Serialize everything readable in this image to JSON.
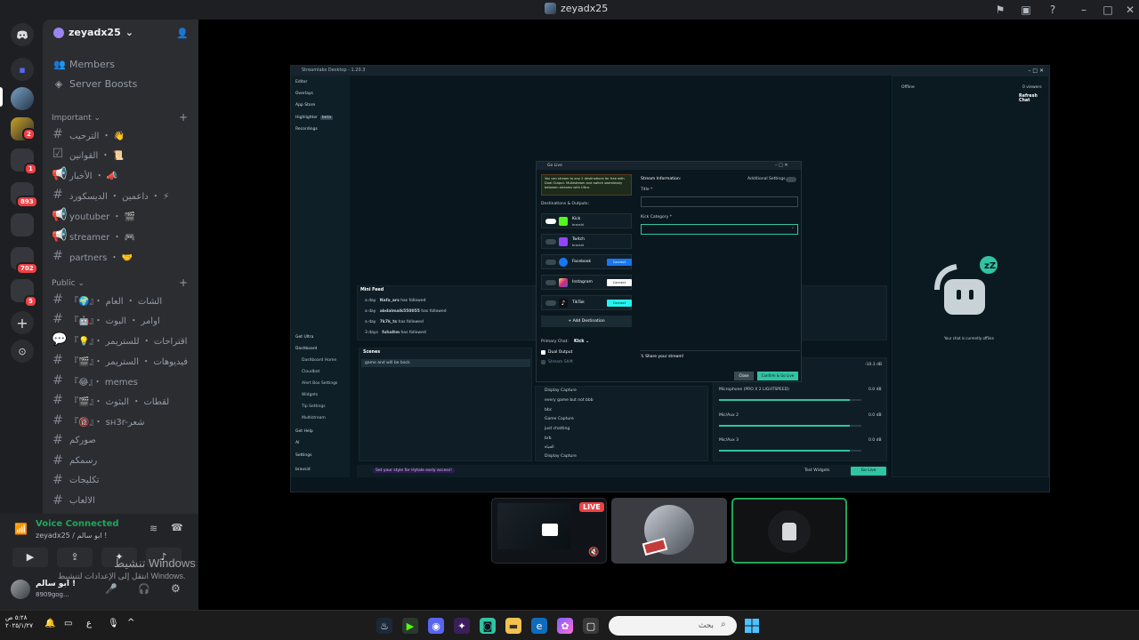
{
  "window": {
    "title": "zeyadx25"
  },
  "server": {
    "name": "zeyadx25"
  },
  "sidebar": {
    "top_items": [
      {
        "label": "Members",
        "icon": "members-icon"
      },
      {
        "label": "Server Boosts",
        "icon": "boost-icon"
      }
    ],
    "categories": [
      {
        "label": "Important",
        "channels": [
          {
            "label": "الترحيب ・ 👋",
            "type": "text"
          },
          {
            "label": "القوانين ・ 📜",
            "type": "rules"
          },
          {
            "label": "الأخبار ・ 📣",
            "type": "announce"
          },
          {
            "label": "داعمين ・ الديسكورد ・ ⚡",
            "type": "text"
          },
          {
            "label": "youtuber ・ 🎬",
            "type": "announce"
          },
          {
            "label": "streamer ・ 🎮",
            "type": "announce"
          },
          {
            "label": "partners ・ 🤝",
            "type": "text"
          }
        ]
      },
      {
        "label": "Public",
        "channels": [
          {
            "label": "『🌍』・ الشات ・ العام",
            "type": "text"
          },
          {
            "label": "『🤖』・ اوامر ・ البوت",
            "type": "text"
          },
          {
            "label": "『💡』・ اقتراحات ・ للستريمر",
            "type": "forum"
          },
          {
            "label": "『🎬』・ فيديوهات ・ الستريمر",
            "type": "text"
          },
          {
            "label": "『😂』・ memes",
            "type": "text"
          },
          {
            "label": "『🎬』・ لقطات ・ البثوث",
            "type": "text"
          },
          {
            "label": "『🔞』・ sн3r-شعر",
            "type": "text"
          },
          {
            "label": "صوركم",
            "type": "text"
          },
          {
            "label": "رسمكم",
            "type": "text"
          },
          {
            "label": "تكليجات",
            "type": "text"
          },
          {
            "label": "الالعاب",
            "type": "text"
          }
        ]
      }
    ]
  },
  "rail_badges": [
    "2",
    "1",
    "893",
    "702",
    "5"
  ],
  "voice": {
    "status": "Voice Connected",
    "channel": "zeyadx25 / ابو سالم !",
    "user_name": "ابو سالم !",
    "user_tag": "8909gog...",
    "watermark_title": "تنشيط Windows",
    "watermark_sub": "انتقل إلى الإعدادات لتنشيط Windows."
  },
  "streamlabs": {
    "title": "Streamlabs Desktop - 1.20.3",
    "nav": [
      "Editor",
      "Overlays",
      "App Store",
      "Highlighter",
      "Recordings"
    ],
    "highlighter_badge": "beta",
    "nav_bottom": [
      "Get Ultra",
      "Dashboard",
      "Dashboard Home",
      "Cloudbot",
      "Alert Box Settings",
      "Widgets",
      "Tip Settings",
      "Multistream",
      "Get Help",
      "AI",
      "Settings",
      "bravsid"
    ],
    "chat": {
      "status": "Offline",
      "viewers": "0 viewers",
      "refresh": "Refresh Chat",
      "offline_msg": "Your chat is currently offline"
    },
    "mini_feed": {
      "title": "Mini Feed",
      "events": [
        {
          "time": "a day",
          "user": "Nafa_ars",
          "action": "has followed"
        },
        {
          "time": "a day",
          "user": "abdalmalk550055",
          "action": "has followed"
        },
        {
          "time": "a day",
          "user": "7k7k_ts",
          "action": "has followed"
        },
        {
          "time": "3 days",
          "user": "fuhaltm",
          "action": "has followed"
        }
      ]
    },
    "scenes": {
      "title": "Scenes",
      "items": [
        "game and will be back"
      ]
    },
    "sources": [
      "Display Capture",
      "every game but not bbb",
      "bbc",
      "Game Capture",
      "just chatting",
      "brb",
      "الحياة",
      "Display Capture"
    ],
    "mixer": [
      {
        "name": "Microphone (PRO X 2 LIGHTSPEED)",
        "db": "0.0 dB",
        "level": 0.92
      },
      {
        "name": "Mic/Aux 2",
        "db": "0.0 dB",
        "level": 0.92
      },
      {
        "name": "Mic/Aux 3",
        "db": "0.0 dB",
        "level": 0.92
      }
    ],
    "mixer_top_db": "-10.3 dB",
    "footer": {
      "promo": "Set your style for Hytale early access!",
      "test_widgets": "Test Widgets",
      "go_live": "Go Live"
    }
  },
  "golive": {
    "title": "Go Live",
    "notice": "You can stream to any 2 destinations for free with Dual Output. Multistream and switch seamlessly between streams with Ultra.",
    "destinations_label": "Destinations & Outputs:",
    "destinations": [
      {
        "name": "Kick",
        "sub": "bravsid",
        "on": true,
        "color": "#53fc18",
        "button": ""
      },
      {
        "name": "Twitch",
        "sub": "bravsid",
        "on": false,
        "color": "#9146ff",
        "button": ""
      },
      {
        "name": "Facebook",
        "sub": "",
        "on": false,
        "color": "#1877f2",
        "button": "Connect"
      },
      {
        "name": "Instagram",
        "sub": "",
        "on": false,
        "color": "#e1306c",
        "button": "Connect"
      },
      {
        "name": "TikTok",
        "sub": "",
        "on": false,
        "color": "#000000",
        "button": "Connect"
      }
    ],
    "add_destination": "Add Destination",
    "primary_chat_label": "Primary Chat:",
    "primary_chat_value": "Kick",
    "dual_output": "Dual Output",
    "stream_shift": "Stream Shift",
    "stream_info": "Stream Information:",
    "additional_settings": "Additional Settings",
    "title_label": "Title",
    "category_label": "Kick Category",
    "share": "Share your stream!",
    "close": "Close",
    "confirm": "Confirm & Go Live"
  },
  "stage": {
    "live_badge": "LIVE"
  },
  "taskbar": {
    "search_placeholder": "بحث",
    "time": "٥:٢٨ ص",
    "date": "٢٠٢٥/١/٢٧",
    "lang": "ع"
  }
}
